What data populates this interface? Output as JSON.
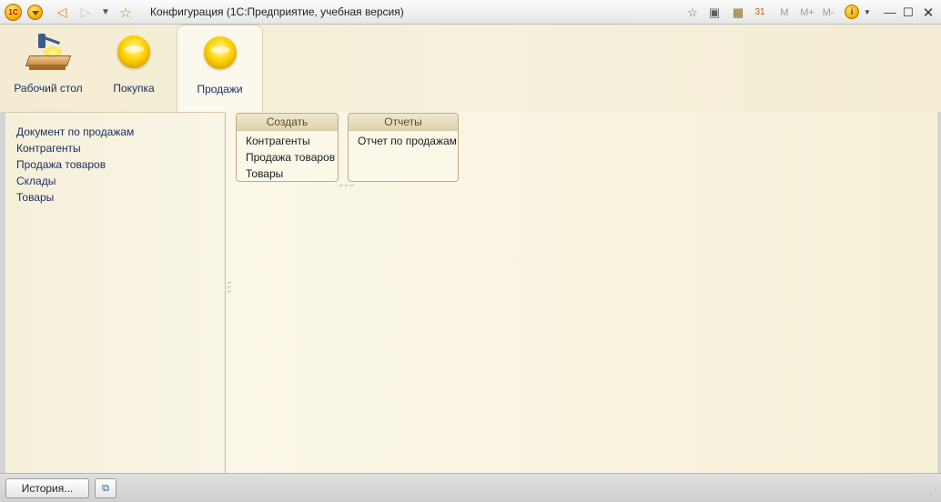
{
  "window": {
    "title": "Конфигурация  (1С:Предприятие, учебная версия)",
    "logo_text": "1C",
    "toolbar_icons": [
      "add-favorite-icon",
      "history-list-icon",
      "calculator-icon",
      "calendar-icon"
    ],
    "memory_buttons": [
      "M",
      "M+",
      "M-"
    ]
  },
  "sections": [
    {
      "label": "Рабочий стол",
      "icon": "desk-lamp-icon",
      "active": false
    },
    {
      "label": "Покупка",
      "icon": "gold-circle-icon",
      "active": false
    },
    {
      "label": "Продажи",
      "icon": "gold-circle-icon",
      "active": true
    }
  ],
  "nav_panel": {
    "items": [
      {
        "label": "Документ по продажам"
      },
      {
        "label": "Контрагенты"
      },
      {
        "label": "Продажа товаров"
      },
      {
        "label": "Склады"
      },
      {
        "label": "Товары"
      }
    ]
  },
  "actions": {
    "create": {
      "title": "Создать",
      "items": [
        {
          "label": "Контрагенты"
        },
        {
          "label": "Продажа товаров"
        },
        {
          "label": "Товары"
        }
      ]
    },
    "reports": {
      "title": "Отчеты",
      "items": [
        {
          "label": "Отчет по продажам"
        }
      ]
    }
  },
  "statusbar": {
    "history_label": "История..."
  },
  "colors": {
    "accent_gold": "#f5b400",
    "link_blue": "#1c2c5e",
    "panel_bg": "#f7f0d8"
  }
}
